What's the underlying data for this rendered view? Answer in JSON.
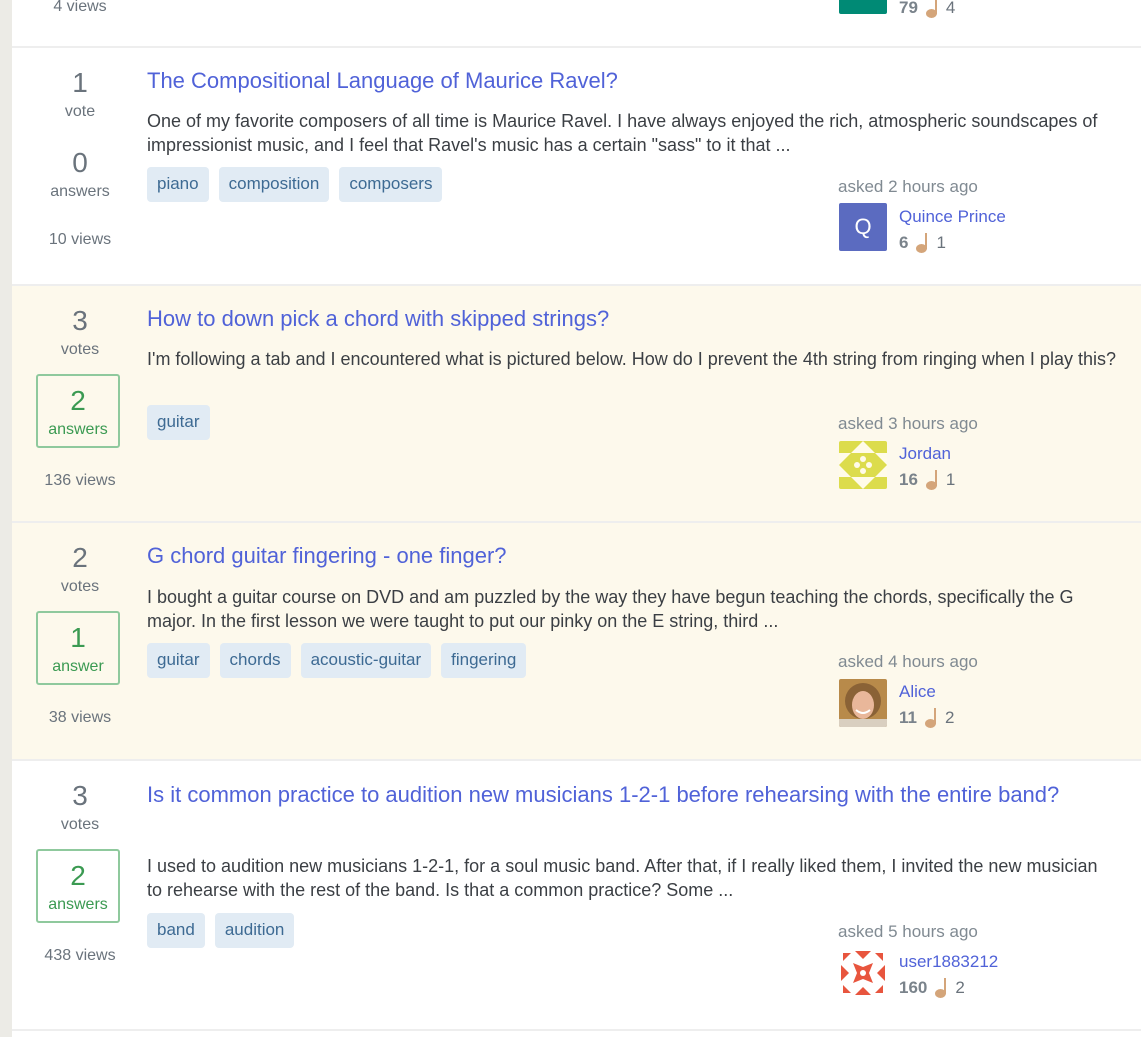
{
  "top_partial": {
    "views": "4 views",
    "reputation": "79",
    "bronze_badges": "4",
    "avatar_color": "#008a75"
  },
  "questions": [
    {
      "votes": "1",
      "votes_label": "vote",
      "answers": "0",
      "answers_label": "answers",
      "views": "10 views",
      "title": "The Compositional Language of Maurice Ravel?",
      "excerpt": "One of my favorite composers of all time is Maurice Ravel. I have always enjoyed the rich, atmospheric soundscapes of impressionist music, and I feel that Ravel's music has a certain \"sass\" to it that ...",
      "tags": [
        "piano",
        "composition",
        "composers"
      ],
      "asked": "asked 2 hours ago",
      "user": "Quince Prince",
      "avatar_letter": "Q",
      "avatar_color": "#5b6bc0",
      "reputation": "6",
      "badges": "1"
    },
    {
      "votes": "3",
      "votes_label": "votes",
      "answers": "2",
      "answers_label": "answers",
      "views": "136 views",
      "title": "How to down pick a chord with skipped strings?",
      "excerpt": "I'm following a tab and I encountered what is pictured below. How do I prevent the 4th string from ringing when I play this?",
      "tags": [
        "guitar"
      ],
      "asked": "asked 3 hours ago",
      "user": "Jordan",
      "avatar_color": "#dcdc4c",
      "reputation": "16",
      "badges": "1"
    },
    {
      "votes": "2",
      "votes_label": "votes",
      "answers": "1",
      "answers_label": "answer",
      "views": "38 views",
      "title": "G chord guitar fingering - one finger?",
      "excerpt": "I bought a guitar course on DVD and am puzzled by the way they have begun teaching the chords, specifically the G major. In the first lesson we were taught to put our pinky on the E string, third ...",
      "tags": [
        "guitar",
        "chords",
        "acoustic-guitar",
        "fingering"
      ],
      "asked": "asked 4 hours ago",
      "user": "Alice",
      "reputation": "11",
      "badges": "2"
    },
    {
      "votes": "3",
      "votes_label": "votes",
      "answers": "2",
      "answers_label": "answers",
      "views": "438 views",
      "title": "Is it common practice to audition new musicians 1-2-1 before rehearsing with the entire band?",
      "excerpt": "I used to audition new musicians 1-2-1, for a soul music band. After that, if I really liked them, I invited the new musician to rehearse with the rest of the band. Is that a common practice? Some ...",
      "tags": [
        "band",
        "audition"
      ],
      "asked": "asked 5 hours ago",
      "user": "user1883212",
      "avatar_color": "#e8553e",
      "reputation": "160",
      "badges": "2"
    }
  ]
}
